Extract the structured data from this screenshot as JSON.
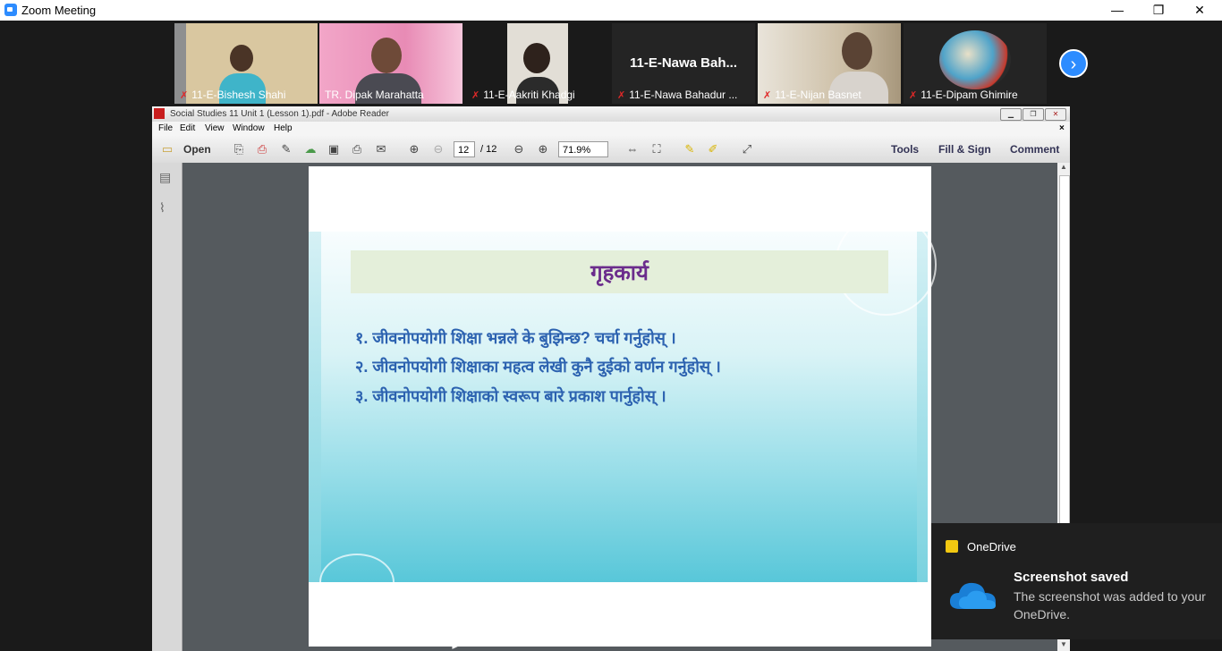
{
  "zoom": {
    "title": "Zoom Meeting",
    "window_buttons": {
      "minimize": "—",
      "restore": "❐",
      "close": "✕"
    }
  },
  "participants": [
    {
      "name": "11-E-Bishesh Shahi",
      "muted": true,
      "bg": "#c8b896",
      "fg": "#b5a07a"
    },
    {
      "name": "TR. Dipak Marahatta",
      "muted": false,
      "bg": "#e58ab8",
      "fg": "#6b5a4e",
      "active": true
    },
    {
      "name": "11-E-Aakriti Khadgi",
      "muted": true,
      "bg": "#e6e2da",
      "fg": "#3a2a22"
    },
    {
      "name": "11-E-Nawa Bahadur ...",
      "muted": true,
      "bg": "#222222",
      "fg": "#222222",
      "label": "11-E-Nawa Bah..."
    },
    {
      "name": "11-E-Nijan Basnet",
      "muted": true,
      "bg": "#cfc2a8",
      "fg": "#5a4638"
    },
    {
      "name": "11-E-Dipam Ghimire",
      "muted": true,
      "bg": "#2a2a2a",
      "fg": "#c44a3a"
    }
  ],
  "next_icon": "chevron-right",
  "reader": {
    "title": "Social Studies 11 Unit 1 (Lesson 1).pdf - Adobe Reader",
    "menu": [
      "File",
      "Edit",
      "View",
      "Window",
      "Help"
    ],
    "open_label": "Open",
    "page_current": "12",
    "page_total": "/ 12",
    "zoom_value": "71.9%",
    "tools_label": "Tools",
    "fill_sign_label": "Fill & Sign",
    "comment_label": "Comment",
    "close_x": "×"
  },
  "slide": {
    "heading": "गृहकार्य",
    "questions": [
      "१. जीवनोपयोगी शिक्षा भन्नले के बुझिन्छ? चर्चा गर्नुहोस् ।",
      "२. जीवनोपयोगी शिक्षाका महत्व लेखी कुनै दुईको वर्णन गर्नुहोस् ।",
      "३. जीवनोपयोगी शिक्षाको स्वरूप बारे प्रकाश पार्नुहोस् ।"
    ]
  },
  "toast": {
    "app": "OneDrive",
    "heading": "Screenshot saved",
    "body": "The screenshot was added to your OneDrive."
  },
  "colors": {
    "zoom_blue": "#2d8cff",
    "heading_purple": "#6b2c8c",
    "question_blue": "#2c62b0",
    "active_border": "#9ad14b"
  }
}
